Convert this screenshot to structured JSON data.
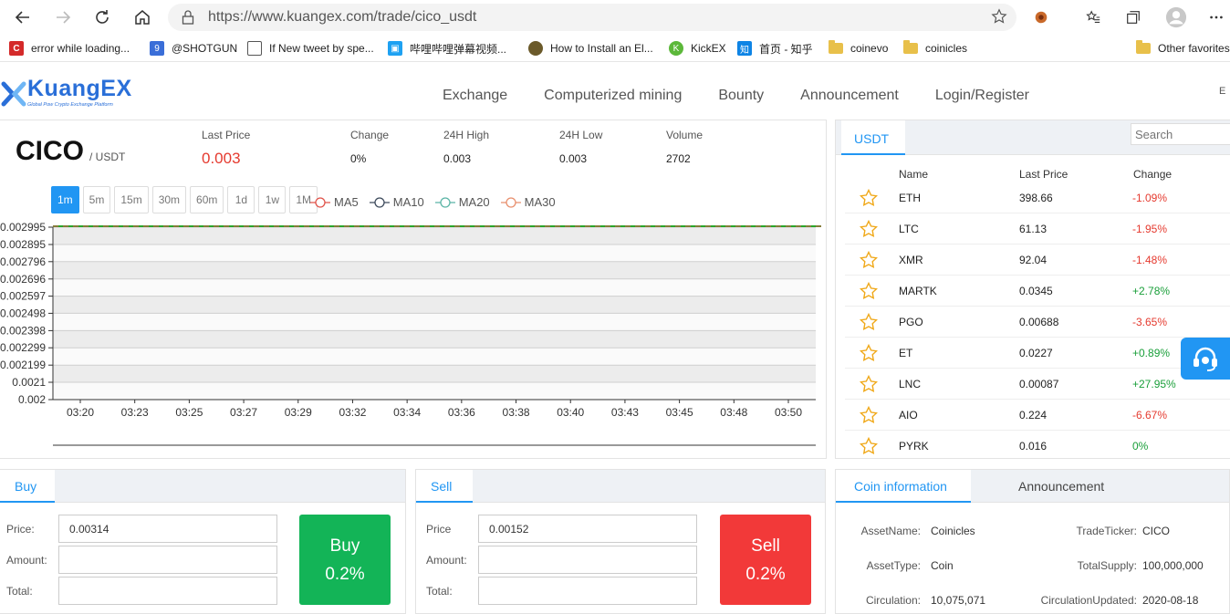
{
  "browser": {
    "url": "https://www.kuangex.com/trade/cico_usdt",
    "bookmarks": [
      {
        "label": "error while loading...",
        "icon": "red-c-icon"
      },
      {
        "label": "@SHOTGUN",
        "icon": "shotgun-icon"
      },
      {
        "label": "If New tweet by spe...",
        "icon": "page-icon"
      },
      {
        "label": "哔哩哔哩弹幕视频...",
        "icon": "bilibili-icon"
      },
      {
        "label": "How to Install an El...",
        "icon": "site-icon"
      },
      {
        "label": "KickEX",
        "icon": "kickex-icon"
      },
      {
        "label": "首页 - 知乎",
        "icon": "zhihu-icon"
      },
      {
        "label": "coinevo",
        "icon": "folder-icon"
      },
      {
        "label": "coinicles",
        "icon": "folder-icon"
      }
    ],
    "other_favorites": "Other favorites"
  },
  "site": {
    "logo": "KuangEX",
    "tagline": "Global Pow Crypto Exchange Platform",
    "nav": [
      "Exchange",
      "Computerized mining",
      "Bounty",
      "Announcement",
      "Login/Register"
    ],
    "lang_stub": "E"
  },
  "ticker": {
    "pair": "CICO",
    "quote": "/ USDT",
    "labels": {
      "last": "Last Price",
      "change": "Change",
      "high": "24H High",
      "low": "24H Low",
      "volume": "Volume"
    },
    "values": {
      "last": "0.003",
      "change": "0%",
      "high": "0.003",
      "low": "0.003",
      "volume": "2702"
    }
  },
  "timeframes": [
    "1m",
    "5m",
    "15m",
    "30m",
    "60m",
    "1d",
    "1w",
    "1M"
  ],
  "active_timeframe": "1m",
  "ma_legend": [
    {
      "label": "MA5",
      "color": "#e0534a"
    },
    {
      "label": "MA10",
      "color": "#3d4a5c"
    },
    {
      "label": "MA20",
      "color": "#5bb5a6"
    },
    {
      "label": "MA30",
      "color": "#e88f6d"
    }
  ],
  "chart_data": {
    "type": "line",
    "title": "",
    "xlabel": "",
    "ylabel": "",
    "x_ticks": [
      "03:20",
      "03:23",
      "03:25",
      "03:27",
      "03:29",
      "03:32",
      "03:34",
      "03:36",
      "03:38",
      "03:40",
      "03:43",
      "03:45",
      "03:48",
      "03:50"
    ],
    "y_ticks": [
      "0.002995",
      "0.002895",
      "0.002796",
      "0.002696",
      "0.002597",
      "0.002498",
      "0.002398",
      "0.002299",
      "0.002199",
      "0.0021",
      "0.002"
    ],
    "ylim": [
      0.002,
      0.002995
    ],
    "series": [
      {
        "values": [
          0.003,
          0.003,
          0.003,
          0.003,
          0.003,
          0.003,
          0.003,
          0.003,
          0.003,
          0.003,
          0.003,
          0.003,
          0.003,
          0.003
        ],
        "color": "#2aa52a"
      }
    ],
    "grid": true
  },
  "market": {
    "tab": "USDT",
    "search_placeholder": "Search",
    "headers": {
      "name": "Name",
      "price": "Last Price",
      "change": "Change"
    },
    "rows": [
      {
        "name": "ETH",
        "price": "398.66",
        "change": "-1.09%",
        "dir": "down"
      },
      {
        "name": "LTC",
        "price": "61.13",
        "change": "-1.95%",
        "dir": "down"
      },
      {
        "name": "XMR",
        "price": "92.04",
        "change": "-1.48%",
        "dir": "down"
      },
      {
        "name": "MARTK",
        "price": "0.0345",
        "change": "+2.78%",
        "dir": "up"
      },
      {
        "name": "PGO",
        "price": "0.00688",
        "change": "-3.65%",
        "dir": "down"
      },
      {
        "name": "ET",
        "price": "0.0227",
        "change": "+0.89%",
        "dir": "up"
      },
      {
        "name": "LNC",
        "price": "0.00087",
        "change": "+27.95%",
        "dir": "up"
      },
      {
        "name": "AIO",
        "price": "0.224",
        "change": "-6.67%",
        "dir": "down"
      },
      {
        "name": "PYRK",
        "price": "0.016",
        "change": "0%",
        "dir": "up"
      }
    ]
  },
  "buy": {
    "tab": "Buy",
    "price_label": "Price:",
    "amount_label": "Amount:",
    "total_label": "Total:",
    "price": "0.00314",
    "amount": "",
    "total": "",
    "button": "Buy",
    "fee": "0.2%"
  },
  "sell": {
    "tab": "Sell",
    "price_label": "Price",
    "amount_label": "Amount:",
    "total_label": "Total:",
    "price": "0.00152",
    "amount": "",
    "total": "",
    "button": "Sell",
    "fee": "0.2%"
  },
  "coin_info": {
    "tab": "Coin information",
    "tab2": "Announcement",
    "left": [
      {
        "k": "AssetName:",
        "v": "Coinicles"
      },
      {
        "k": "AssetType:",
        "v": "Coin"
      },
      {
        "k": "Circulation:",
        "v": "10,075,071"
      }
    ],
    "right": [
      {
        "k": "TradeTicker:",
        "v": "CICO"
      },
      {
        "k": "TotalSupply:",
        "v": "100,000,000"
      },
      {
        "k": "CirculationUpdated:",
        "v": "2020-08-18"
      }
    ]
  }
}
